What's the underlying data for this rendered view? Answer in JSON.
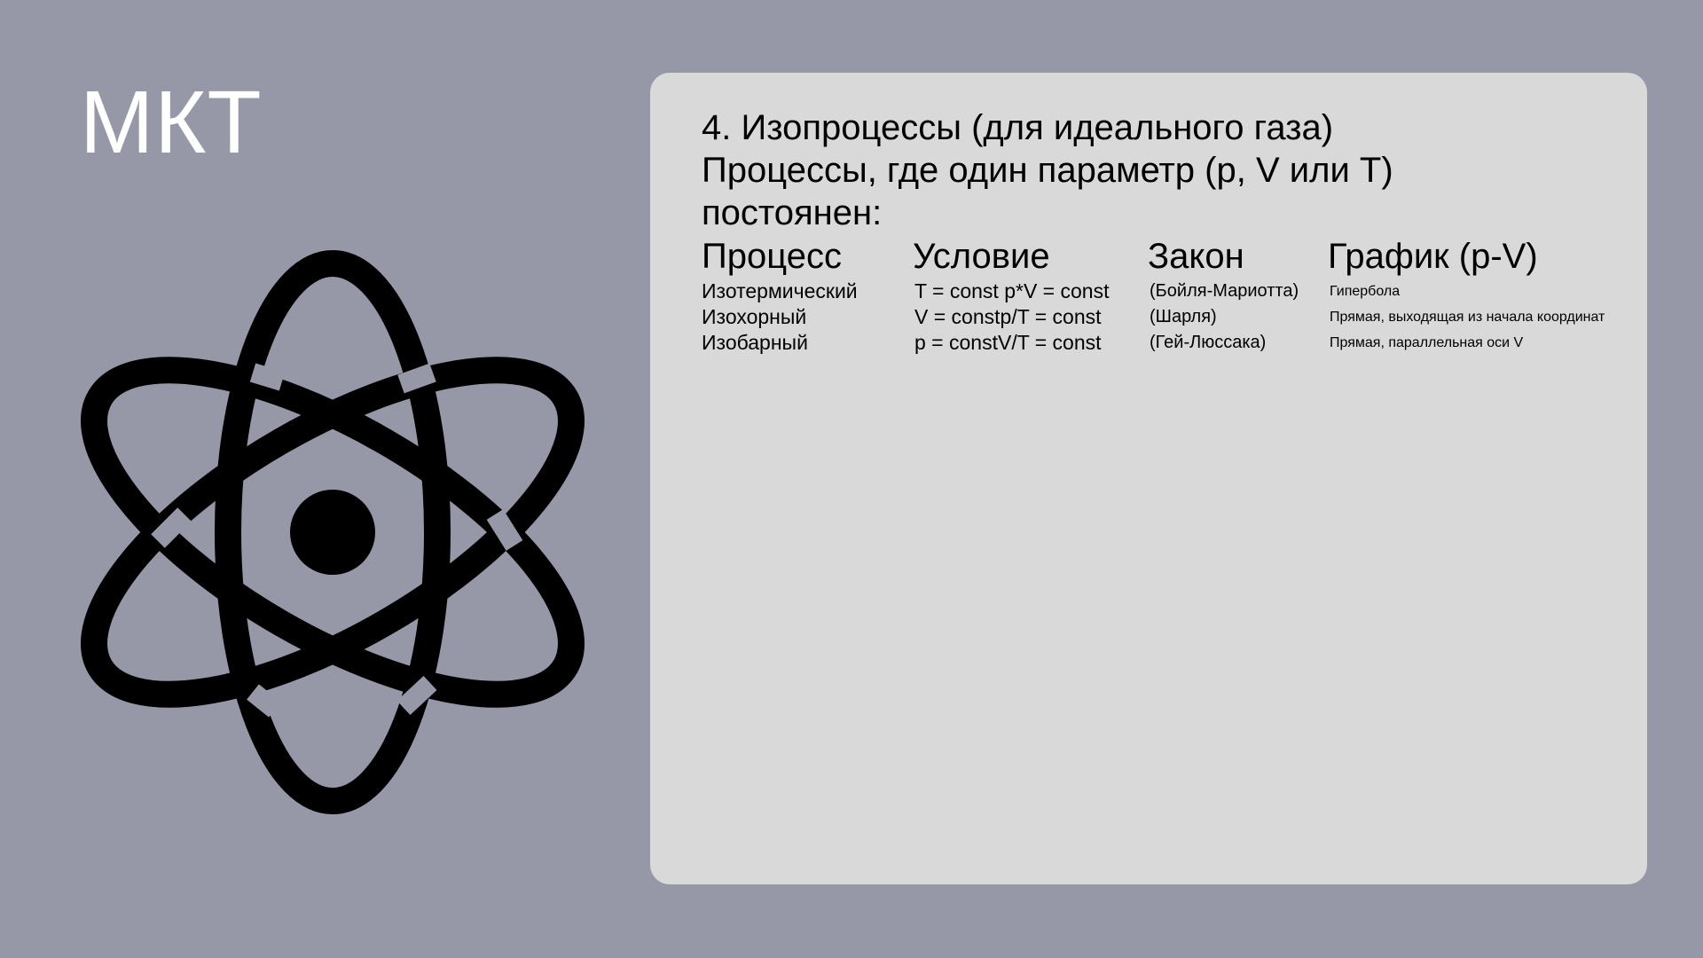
{
  "slide": {
    "title": "МКТ"
  },
  "icon": {
    "name": "atom-icon"
  },
  "card": {
    "lines": [
      "4. Изопроцессы (для идеального газа)",
      "Процессы, где один параметр (p, V или T)",
      "постоянен:"
    ],
    "table": {
      "headers": [
        "Процесс",
        "Условие",
        "Закон",
        "График (p-V)"
      ],
      "rows": [
        {
          "process": "Изотермический",
          "condition": "T = const p*V = const",
          "law": "(Бойля-Мариотта)",
          "graph": "Гипербола"
        },
        {
          "process": "Изохорный",
          "condition": "V = constp/T = const",
          "law": "(Шарля)",
          "graph": "Прямая, выходящая из начала координат"
        },
        {
          "process": "Изобарный",
          "condition": "p = constV/T = const",
          "law": "(Гей-Люссака)",
          "graph": "Прямая, параллельная оси V"
        }
      ]
    }
  },
  "colors": {
    "background": "#9698a8",
    "card": "#d9d9d9",
    "icon": "#000000",
    "title": "#ffffff"
  }
}
